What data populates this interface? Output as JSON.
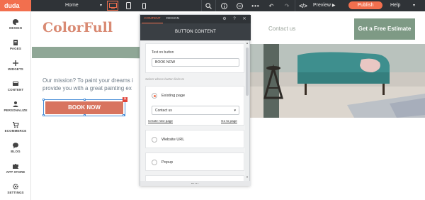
{
  "topbar": {
    "logo": "duda",
    "page_select": "Home",
    "preview_label": "Preview",
    "publish_label": "Publish",
    "help_label": "Help",
    "device_active": "desktop"
  },
  "sidebar": {
    "items": [
      {
        "label": "DESIGN",
        "icon": "palette-icon"
      },
      {
        "label": "PAGES",
        "icon": "pages-icon"
      },
      {
        "label": "WIDGETS",
        "icon": "plus-icon"
      },
      {
        "label": "CONTENT",
        "icon": "content-icon"
      },
      {
        "label": "PERSONALIZE",
        "icon": "person-icon"
      },
      {
        "label": "ECOMMERCE",
        "icon": "cart-icon"
      },
      {
        "label": "BLOG",
        "icon": "chat-bubble-icon"
      },
      {
        "label": "APP STORE",
        "icon": "puzzle-icon"
      },
      {
        "label": "SETTINGS",
        "icon": "gear-icon"
      }
    ]
  },
  "site": {
    "brand": "ColorFull",
    "nav_contact": "Contact us",
    "cta": "Get a Free Estimate",
    "mission_line1": "Our mission? To paint your dreams i",
    "mission_line2": "provide you with a great painting ex",
    "book_button": "BOOK NOW",
    "colors": {
      "brand": "#d98a73",
      "cta": "#7e9a85",
      "button": "#d8745f"
    }
  },
  "panel": {
    "tab_content": "CONTENT",
    "tab_design": "DESIGN",
    "title": "BUTTON CONTENT",
    "text_on_button_label": "Text on button",
    "text_on_button_value": "BOOK NOW",
    "link_hint": "Select where button links to",
    "option_existing": "Existing page",
    "page_value": "Contact us",
    "create_new_page": "Create new page",
    "go_to_page": "Go to page",
    "option_url": "Website URL",
    "option_popup": "Popup",
    "selected_option": "existing"
  },
  "accent_color": "#f26f4e"
}
